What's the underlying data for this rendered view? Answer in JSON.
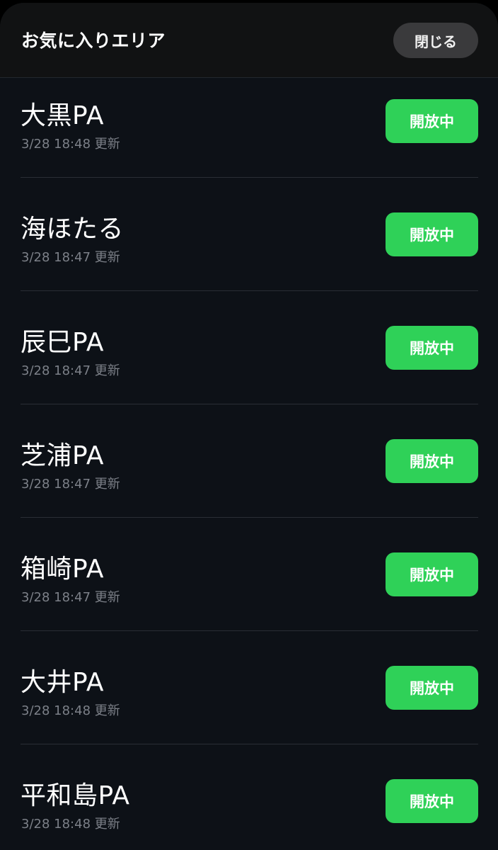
{
  "header": {
    "title": "お気に入りエリア",
    "close_label": "閉じる"
  },
  "items": [
    {
      "name": "大黒PA",
      "updated": "3/28 18:48 更新",
      "status": "開放中"
    },
    {
      "name": "海ほたる",
      "updated": "3/28 18:47 更新",
      "status": "開放中"
    },
    {
      "name": "辰巳PA",
      "updated": "3/28 18:47 更新",
      "status": "開放中"
    },
    {
      "name": "芝浦PA",
      "updated": "3/28 18:47 更新",
      "status": "開放中"
    },
    {
      "name": "箱崎PA",
      "updated": "3/28 18:47 更新",
      "status": "開放中"
    },
    {
      "name": "大井PA",
      "updated": "3/28 18:48 更新",
      "status": "開放中"
    },
    {
      "name": "平和島PA",
      "updated": "3/28 18:48 更新",
      "status": "開放中"
    }
  ],
  "colors": {
    "status_open": "#2fd158",
    "background": "#0d1117"
  }
}
